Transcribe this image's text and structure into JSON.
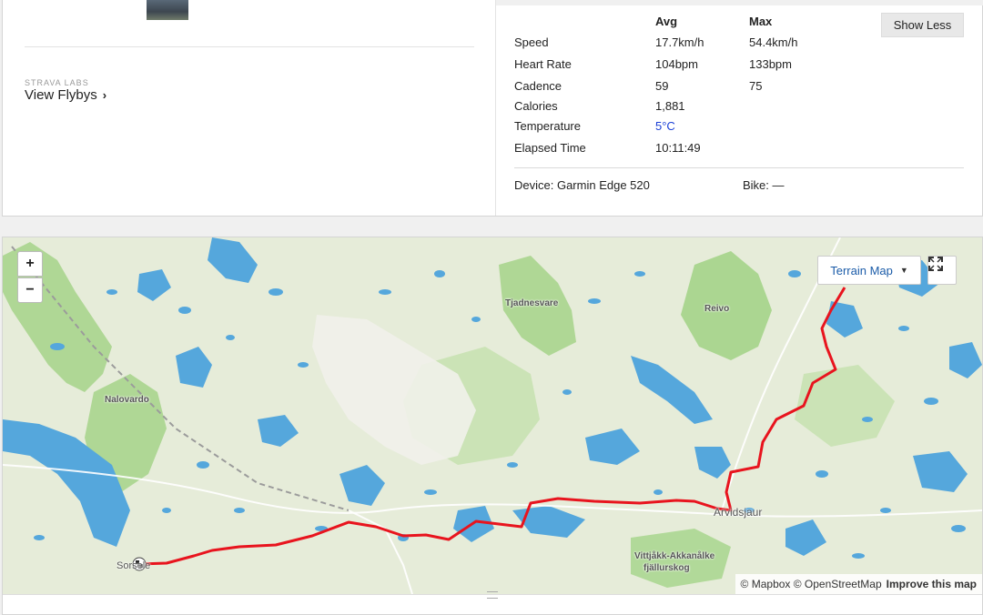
{
  "flybys": {
    "labs_label": "STRAVA LABS",
    "link_label": "View Flybys",
    "chevron": "›"
  },
  "stats": {
    "headers": {
      "avg": "Avg",
      "max": "Max"
    },
    "show_less_label": "Show Less",
    "rows": [
      {
        "label": "Speed",
        "avg": "17.7km/h",
        "max": "54.4km/h"
      },
      {
        "label": "Heart Rate",
        "avg": "104bpm",
        "max": "133bpm"
      },
      {
        "label": "Cadence",
        "avg": "59",
        "max": "75"
      },
      {
        "label": "Calories",
        "avg": "1,881",
        "max": ""
      },
      {
        "label": "Temperature",
        "avg": "5°C",
        "max": ""
      },
      {
        "label": "Elapsed Time",
        "avg": "10:11:49",
        "max": ""
      }
    ],
    "device": "Device: Garmin Edge 520",
    "bike": "Bike: —",
    "temperature_color": "#1a3fd6"
  },
  "map": {
    "zoom_in": "+",
    "zoom_out": "−",
    "terrain_label": "Terrain Map",
    "fullscreen_icon": "expand-icon",
    "places": {
      "tjadnesvare": "Tjadnesvare",
      "reivo": "Reivo",
      "nalovardo": "Nalovardo",
      "arvidsjaur": "Arvidsjaur",
      "vittjakk_1": "Vittjåkk-Akkanålke",
      "vittjakk_2": "fjällurskog",
      "sorsele": "Sorsele"
    },
    "attribution": "© Mapbox © OpenStreetMap",
    "improve": "Improve this map",
    "colors": {
      "route": "#e8141e",
      "water": "#55a7dc",
      "forest": "#9cd27e",
      "land": "#e6ecd9"
    }
  }
}
